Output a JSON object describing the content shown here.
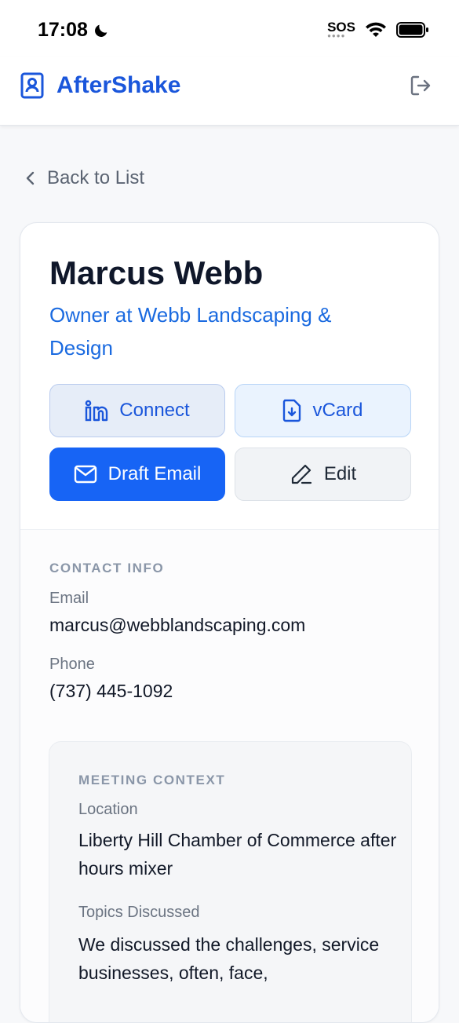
{
  "status": {
    "time": "17:08",
    "sos": "SOS"
  },
  "header": {
    "brand": "AfterShake"
  },
  "nav": {
    "back_label": "Back to List"
  },
  "contact": {
    "name": "Marcus Webb",
    "title": "Owner at Webb Landscaping & Design"
  },
  "actions": {
    "connect": "Connect",
    "vcard": "vCard",
    "draft_email": "Draft Email",
    "edit": "Edit"
  },
  "contact_info": {
    "section": "CONTACT INFO",
    "email_label": "Email",
    "email": "marcus@webblandscaping.com",
    "phone_label": "Phone",
    "phone": "(737) 445-1092"
  },
  "meeting_context": {
    "section": "MEETING CONTEXT",
    "location_label": "Location",
    "location": "Liberty Hill Chamber of Commerce after hours mixer",
    "topics_label": "Topics Discussed",
    "topics": "We discussed the challenges, service businesses, often, face,"
  },
  "colors": {
    "brand": "#1a56db",
    "primary_button": "#1764f5"
  }
}
